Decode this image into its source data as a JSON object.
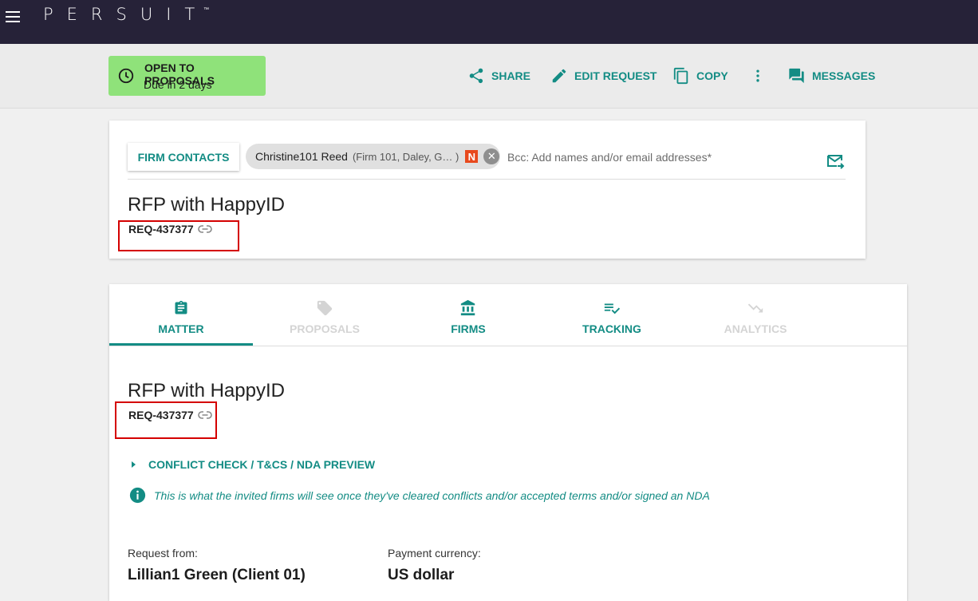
{
  "topbar": {
    "logo": "PERSUIT",
    "trademark": "™"
  },
  "status": {
    "title": "OPEN TO PROPOSALS",
    "subtitle": "Due in 2 days"
  },
  "actions": {
    "share": "SHARE",
    "edit_request": "EDIT REQUEST",
    "copy": "COPY",
    "messages": "MESSAGES"
  },
  "contacts": {
    "button_label": "FIRM CONTACTS",
    "chip_name": "Christine101 Reed",
    "chip_firm": "(Firm 101, Daley, G… )",
    "chip_badge": "N",
    "bcc_placeholder": "Bcc: Add names and/or email addresses*"
  },
  "request": {
    "title": "RFP with HappyID",
    "id": "REQ-437377"
  },
  "tabs": [
    {
      "label": "MATTER",
      "icon": "clipboard-icon",
      "active": true,
      "disabled": false
    },
    {
      "label": "PROPOSALS",
      "icon": "tag-icon",
      "active": false,
      "disabled": true
    },
    {
      "label": "FIRMS",
      "icon": "bank-icon",
      "active": false,
      "disabled": false
    },
    {
      "label": "TRACKING",
      "icon": "playlist-check-icon",
      "active": false,
      "disabled": false
    },
    {
      "label": "ANALYTICS",
      "icon": "trending-down-icon",
      "active": false,
      "disabled": true
    }
  ],
  "matter": {
    "title": "RFP with HappyID",
    "id": "REQ-437377",
    "conflict_toggle": "CONFLICT CHECK / T&CS / NDA PREVIEW",
    "info_message": "This is what the invited firms will see once they've cleared conflicts and/or accepted terms and/or signed an NDA",
    "request_from_label": "Request from:",
    "request_from_value": "Lillian1 Green (Client 01)",
    "payment_currency_label": "Payment currency:",
    "payment_currency_value": "US dollar"
  },
  "colors": {
    "topbar": "#262238",
    "accent": "#138c84",
    "status_bg": "#8fe27a",
    "highlight_box": "#d40000"
  }
}
